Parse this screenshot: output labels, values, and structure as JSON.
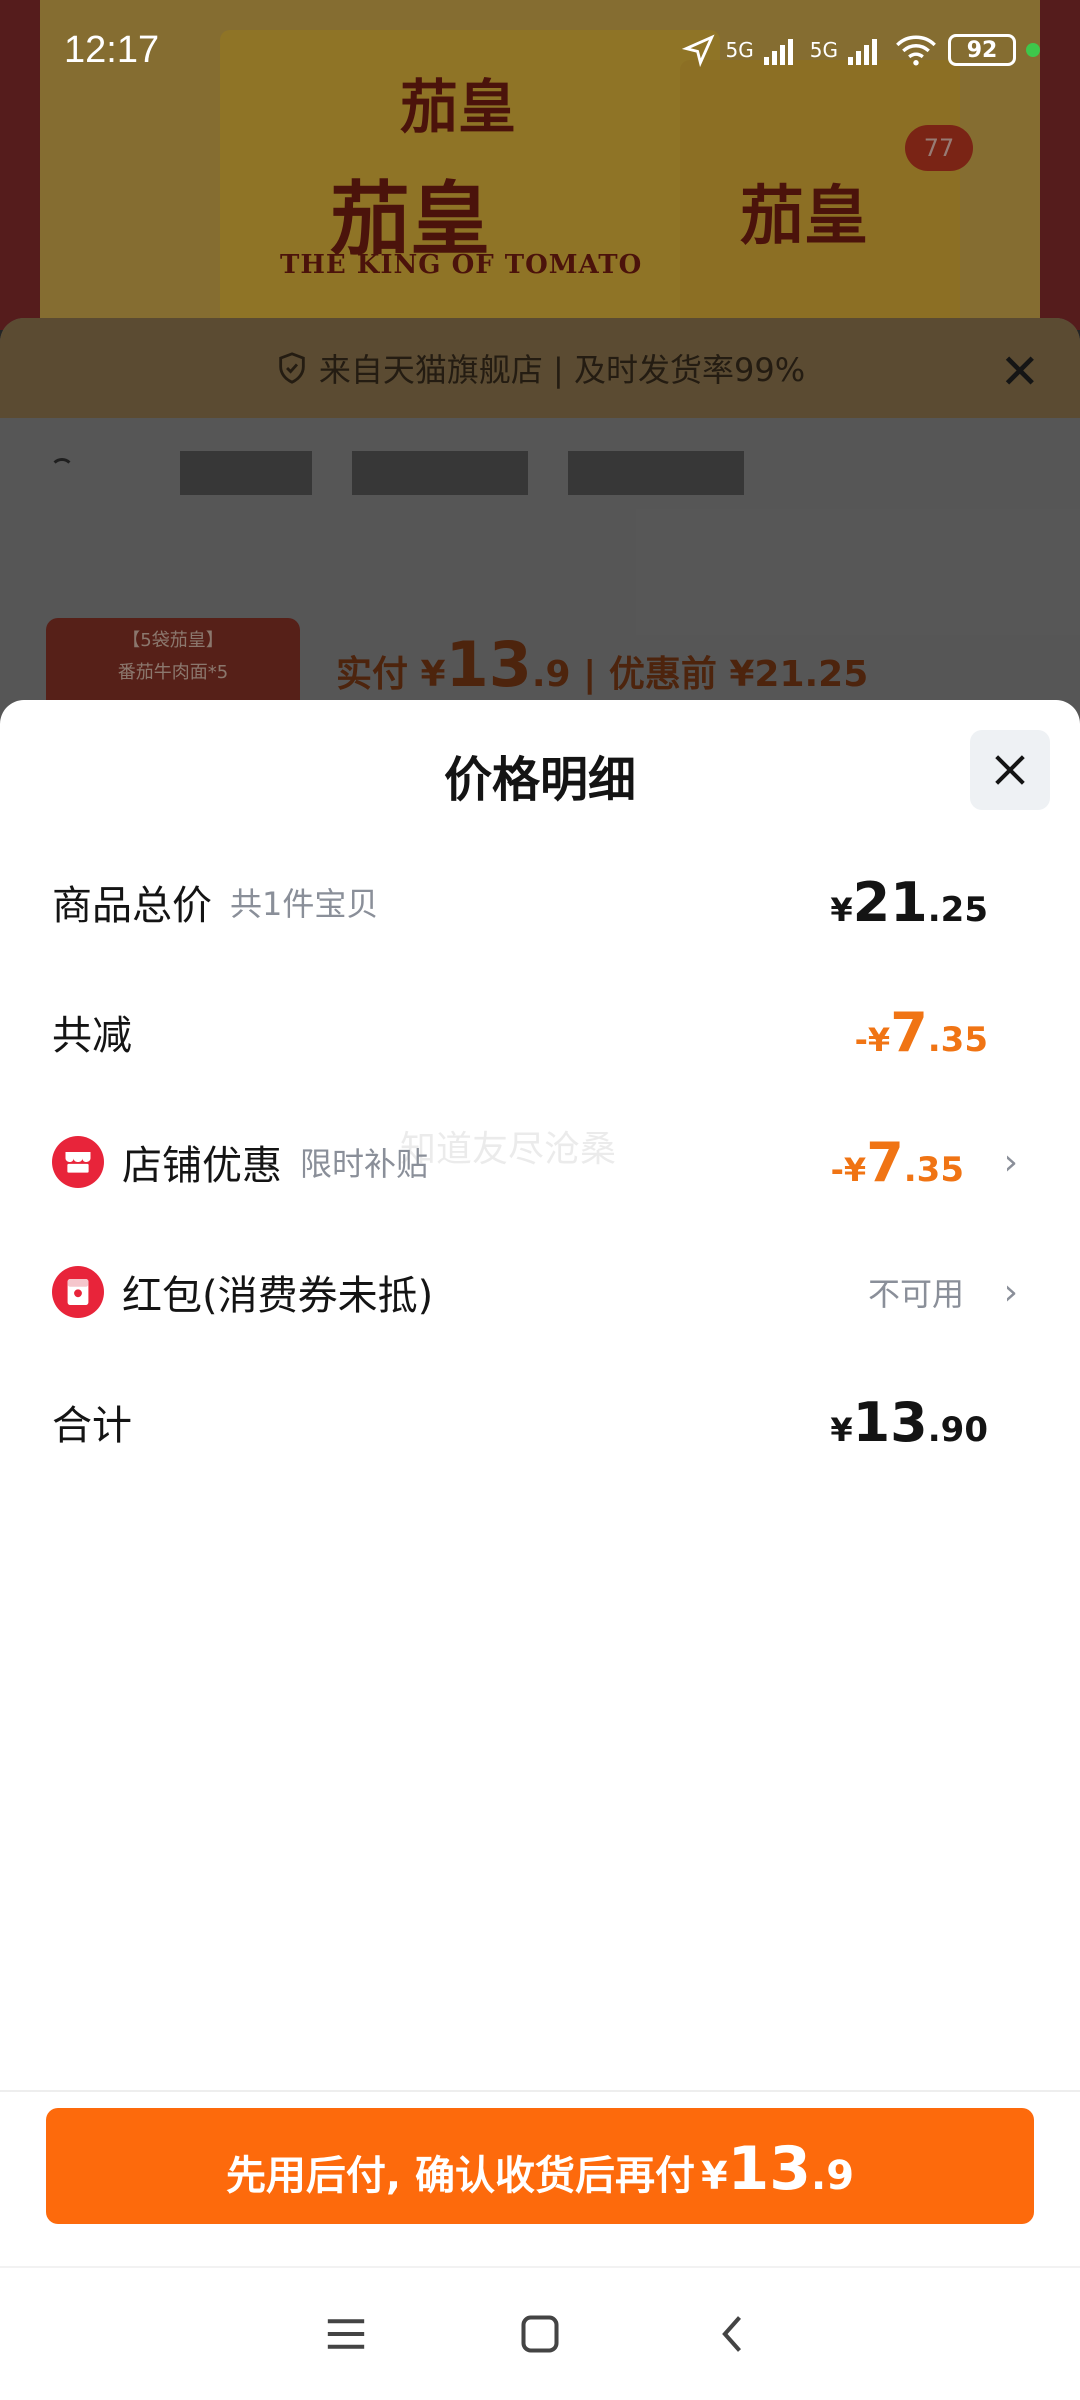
{
  "status_bar": {
    "time": "12:17",
    "signal_1": "5G",
    "signal_2": "5G",
    "battery": "92"
  },
  "background": {
    "brand_top": "茄皇",
    "brand_main": "茄皇",
    "brand_en": "THE KING OF TOMATO",
    "brand_side": "茄皇",
    "count_badge": "77",
    "tmall_banner": "来自天猫旗舰店 | 及时发货率99%",
    "promo_card_title": "【5袋茄皇】",
    "promo_card_sub": "番茄牛肉面*5",
    "promo_price_label": "实付 ¥",
    "promo_price_int": "13",
    "promo_price_dec": ".9",
    "promo_original": " | 优惠前 ¥21.25"
  },
  "sheet": {
    "title": "价格明细",
    "watermark": "知道友尽沧桑",
    "rows": [
      {
        "label": "商品总价",
        "sub": "共1件宝贝",
        "cur": "¥",
        "int": "21",
        "dec": ".25"
      },
      {
        "label": "共减",
        "cur": "-¥",
        "int": "7",
        "dec": ".35"
      },
      {
        "label": "店铺优惠",
        "sub": "限时补贴",
        "cur": "-¥",
        "int": "7",
        "dec": ".35"
      },
      {
        "label": "红包(消费券未抵)",
        "status": "不可用"
      },
      {
        "label": "合计",
        "cur": "¥",
        "int": "13",
        "dec": ".90"
      }
    ]
  },
  "pay_button": {
    "label": "先用后付, 确认收货后再付",
    "cur": "¥",
    "int": "13",
    "dec": ".9"
  },
  "colors": {
    "accent": "#fd6a0c",
    "discount": "#f07414",
    "coupon_icon": "#e8243a"
  }
}
